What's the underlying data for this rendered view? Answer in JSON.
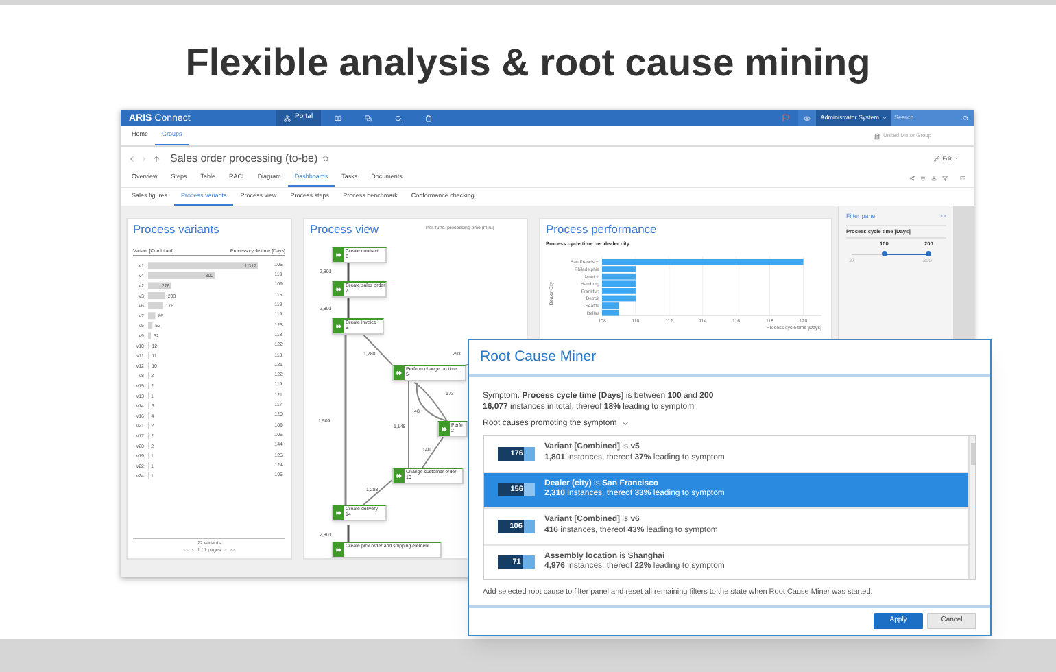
{
  "slide_title": "Flexible analysis & root cause mining",
  "app": {
    "top_bar": {
      "logo_bold": "ARIS",
      "logo_light": "Connect",
      "nav": [
        {
          "label": "Portal",
          "selected": true
        }
      ],
      "user": "Administrator System",
      "search": {
        "placeholder": "Search"
      }
    },
    "nav_tabs": [
      {
        "label": "Home",
        "selected": false
      },
      {
        "label": "Groups",
        "selected": true
      }
    ],
    "group": "United Motor Group",
    "page_title": "Sales order processing (to-be)",
    "edit": "Edit",
    "tabs": [
      {
        "label": "Overview",
        "selected": false
      },
      {
        "label": "Steps",
        "selected": false
      },
      {
        "label": "Table",
        "selected": false
      },
      {
        "label": "RACI",
        "selected": false
      },
      {
        "label": "Diagram",
        "selected": false
      },
      {
        "label": "Dashboards",
        "selected": true
      },
      {
        "label": "Tasks",
        "selected": false
      },
      {
        "label": "Documents",
        "selected": false
      }
    ],
    "subtabs": [
      {
        "label": "Sales figures",
        "selected": false
      },
      {
        "label": "Process variants",
        "selected": true
      },
      {
        "label": "Process view",
        "selected": false
      },
      {
        "label": "Process steps",
        "selected": false
      },
      {
        "label": "Process benchmark",
        "selected": false
      },
      {
        "label": "Conformance checking",
        "selected": false
      }
    ],
    "variants": {
      "title": "Process variants",
      "columns": [
        "Variant [Combined]",
        "Process cycle time [Days]"
      ],
      "chart_data": {
        "type": "bar",
        "orientation": "horizontal",
        "color": "#d4d4d4",
        "value_labels": [
          "1,317",
          "800",
          "276",
          "203",
          "176",
          "86",
          "52",
          "32",
          "12",
          "11",
          "10",
          "2",
          "2",
          "1",
          "6",
          "4",
          "2",
          "2",
          "2",
          "1",
          "1",
          "1"
        ],
        "categories": [
          "v1",
          "v4",
          "v2",
          "v3",
          "v6",
          "v7",
          "v5",
          "v9",
          "v10",
          "v11",
          "v12",
          "v8",
          "v15",
          "v13",
          "v14",
          "v16",
          "v21",
          "v17",
          "v20",
          "v19",
          "v22",
          "v24"
        ],
        "values": [
          1317,
          800,
          276,
          203,
          176,
          86,
          52,
          32,
          12,
          11,
          10,
          2,
          2,
          1,
          6,
          4,
          2,
          2,
          2,
          1,
          1,
          1
        ]
      },
      "rows": [
        {
          "cycle_time": "105"
        },
        {
          "cycle_time": "119"
        },
        {
          "cycle_time": "109"
        },
        {
          "cycle_time": "115"
        },
        {
          "cycle_time": "119"
        },
        {
          "cycle_time": "119"
        },
        {
          "cycle_time": "123"
        },
        {
          "cycle_time": "118"
        },
        {
          "cycle_time": "122"
        },
        {
          "cycle_time": "118"
        },
        {
          "cycle_time": "121"
        },
        {
          "cycle_time": "122"
        },
        {
          "cycle_time": "119"
        },
        {
          "cycle_time": "121"
        },
        {
          "cycle_time": "117"
        },
        {
          "cycle_time": "120"
        },
        {
          "cycle_time": "109"
        },
        {
          "cycle_time": "106"
        },
        {
          "cycle_time": "144"
        },
        {
          "cycle_time": "125"
        },
        {
          "cycle_time": "124"
        },
        {
          "cycle_time": "105"
        }
      ],
      "count": "22 variants",
      "pager": {
        "first": "<<",
        "prev": "<",
        "text": "1 / 1 pages",
        "next": ">",
        "last": ">>"
      }
    },
    "process_view": {
      "title": "Process view",
      "hint": "incl. func. processing time [min.]",
      "nodes": [
        {
          "label": "Create contract",
          "count": "8"
        },
        {
          "label": "Create sales order",
          "count": "7"
        },
        {
          "label": "Create invoice",
          "count": "6"
        },
        {
          "label": "Perform change on time",
          "count": "5"
        },
        {
          "label": "Perfo",
          "count": "2"
        },
        {
          "label": "Change customer order",
          "count": "10"
        },
        {
          "label": "Create delivery",
          "count": "14"
        },
        {
          "label": "Create pick order and shipping element"
        }
      ],
      "edge_labels": [
        "2,801",
        "2,801",
        "1,280",
        "293",
        "173",
        "48",
        "1,148",
        "140",
        "1,509",
        "1,288",
        "2,801"
      ]
    },
    "performance": {
      "title": "Process performance",
      "chart_data": {
        "type": "bar",
        "orientation": "horizontal",
        "title": "Process cycle time per dealer city",
        "xlabel": "Process cycle time [Days]",
        "ylabel": "Dealer City",
        "categories": [
          "San Francisco",
          "Philadelphia",
          "Munich",
          "Hamburg",
          "Frankfurt",
          "Detroit",
          "Seattle",
          "Dallas"
        ],
        "series": [
          {
            "color": "#3fa6f0",
            "values": [
              120,
              110,
              110,
              110,
              110,
              110,
              109,
              109
            ]
          }
        ],
        "xlim": [
          108,
          121
        ],
        "grid": true,
        "xticks": [
          108,
          110,
          112,
          114,
          116,
          118,
          120
        ]
      }
    },
    "filter_panel": {
      "title": "Filter panel",
      "collapse": ">>",
      "filter": "Process cycle time [Days]",
      "low": "100",
      "high": "200",
      "min": "27",
      "max": "200",
      "thumbs": [
        {
          "level": 0.42
        },
        {
          "level": 1
        }
      ]
    }
  },
  "dialog": {
    "title": "Root Cause Miner",
    "symptom": "Symptom: **Process cycle time [Days]** is between **100** and **200**",
    "summary": "**16,077** instances in total, thereof **18%** leading to symptom",
    "section": "Root causes promoting the symptom",
    "causes": [
      {
        "score": "176",
        "level": 0.72,
        "title": "**Variant [Combined]** is **v5**",
        "detail": "**1,801** instances, thereof **37%** leading to symptom",
        "selected": false
      },
      {
        "score": "156",
        "level": 0.72,
        "title": "**Dealer (city)** is **San Francisco**",
        "detail": "**2,310** instances, thereof **33%** leading to symptom",
        "selected": true
      },
      {
        "score": "106",
        "level": 0.7,
        "title": "**Variant [Combined]** is **v6**",
        "detail": "**416** instances, thereof **43%** leading to symptom",
        "selected": false
      },
      {
        "score": "71",
        "level": 0.66,
        "title": "**Assembly location** is **Shanghai**",
        "detail": "**4,976** instances, thereof **22%** leading to symptom",
        "selected": false
      }
    ],
    "note": "Add selected root cause to filter panel and reset all remaining filters to the state when Root Cause Miner was started.",
    "buttons": [
      {
        "label": "Apply",
        "kind": "primary"
      },
      {
        "label": "Cancel",
        "kind": "secondary"
      }
    ]
  }
}
